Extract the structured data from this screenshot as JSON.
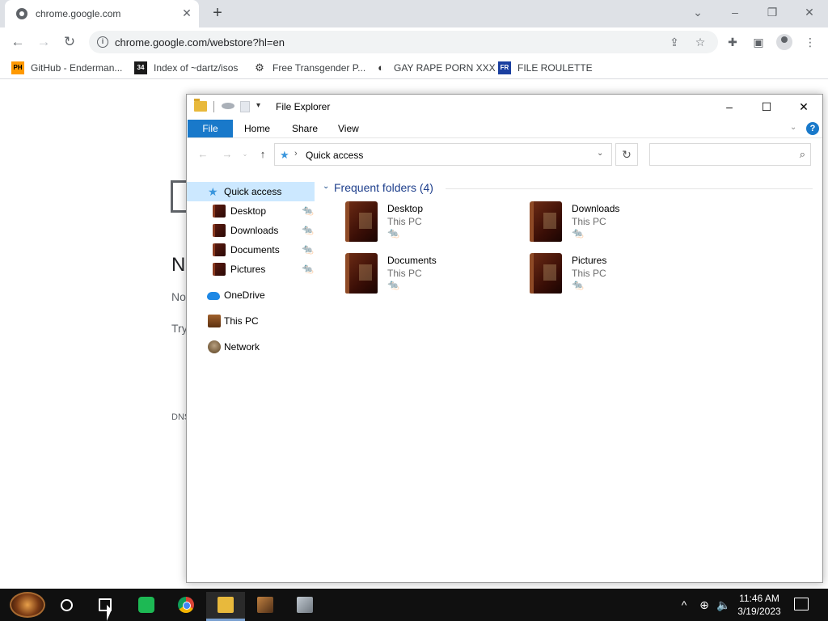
{
  "browser": {
    "tab_title": "chrome.google.com",
    "tab_close": "✕",
    "new_tab": "+",
    "url": "chrome.google.com/webstore?hl=en",
    "bookmarks": [
      {
        "label": "GitHub - Enderman...",
        "icon": "PH"
      },
      {
        "label": "Index of ~dartz/isos",
        "icon": "34"
      },
      {
        "label": "Free Transgender P...",
        "icon": "ft-icon"
      },
      {
        "label": "GAY RAPE PORN XXX",
        "icon": "globe-icon"
      },
      {
        "label": "FILE ROULETTE",
        "icon": "FR"
      }
    ]
  },
  "page": {
    "error_heading": "N",
    "error_line1": "No",
    "error_line2": "Try",
    "error_code": "DNS"
  },
  "explorer": {
    "title": "File Explorer",
    "ribbon": {
      "file": "File",
      "home": "Home",
      "share": "Share",
      "view": "View",
      "help": "?"
    },
    "path": "Quick access",
    "search_placeholder": "",
    "nav": [
      {
        "label": "Quick access",
        "pinned": false
      },
      {
        "label": "Desktop",
        "pinned": true
      },
      {
        "label": "Downloads",
        "pinned": true
      },
      {
        "label": "Documents",
        "pinned": true
      },
      {
        "label": "Pictures",
        "pinned": true
      },
      {
        "label": "OneDrive",
        "pinned": false
      },
      {
        "label": "This PC",
        "pinned": false
      },
      {
        "label": "Network",
        "pinned": false
      }
    ],
    "section_title": "Frequent folders (4)",
    "folders": [
      {
        "name": "Desktop",
        "location": "This PC"
      },
      {
        "name": "Downloads",
        "location": "This PC"
      },
      {
        "name": "Documents",
        "location": "This PC"
      },
      {
        "name": "Pictures",
        "location": "This PC"
      }
    ]
  },
  "taskbar": {
    "time": "11:46 AM",
    "date": "3/19/2023"
  }
}
